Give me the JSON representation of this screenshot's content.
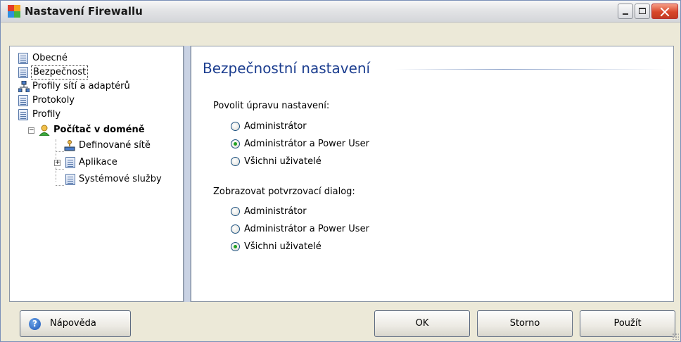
{
  "window": {
    "title": "Nastavení Firewallu"
  },
  "tree": {
    "items": [
      {
        "label": "Obecné",
        "icon": "document-icon"
      },
      {
        "label": "Bezpečnost",
        "icon": "document-icon",
        "selected": true
      },
      {
        "label": "Profily sítí a adaptérů",
        "icon": "network-icon"
      },
      {
        "label": "Protokoly",
        "icon": "document-icon"
      },
      {
        "label": "Profily",
        "icon": "document-icon"
      },
      {
        "label": "Počítač v doméně",
        "icon": "person-icon",
        "bold": true,
        "expanded": true
      },
      {
        "label": "Definované sítě",
        "icon": "network-icon"
      },
      {
        "label": "Aplikace",
        "icon": "document-icon",
        "collapsed": true
      },
      {
        "label": "Systémové služby",
        "icon": "document-icon"
      }
    ]
  },
  "content": {
    "title": "Bezpečnostní nastavení",
    "group1": {
      "label": "Povolit úpravu nastavení:",
      "options": [
        "Administrátor",
        "Administrátor a Power User",
        "Všichni uživatelé"
      ],
      "selected": "Administrátor a Power User"
    },
    "group2": {
      "label": "Zobrazovat potvrzovací dialog:",
      "options": [
        "Administrátor",
        "Administrátor a Power User",
        "Všichni uživatelé"
      ],
      "selected": "Všichni uživatelé"
    }
  },
  "buttons": {
    "help": "Nápověda",
    "ok": "OK",
    "cancel": "Storno",
    "apply": "Použít"
  },
  "colors": {
    "accent_title": "#1b3d8f",
    "radio_dot": "#21a121"
  }
}
